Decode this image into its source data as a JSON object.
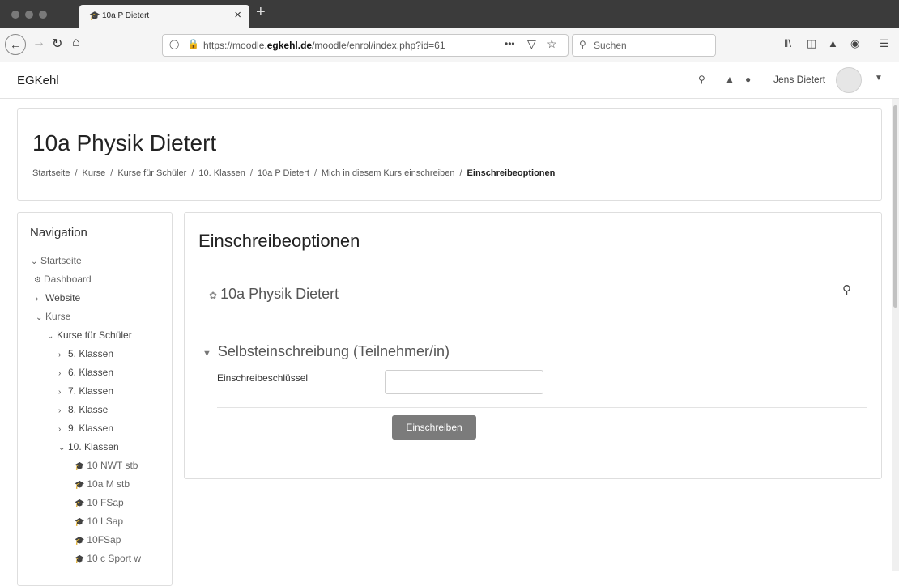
{
  "browser": {
    "tab_title": "10a P Dietert",
    "tab_favicon": "moodle-hat-icon",
    "url_prefix": "https://moodle.",
    "url_domain": "egkehl.de",
    "url_path": "/moodle/enrol/index.php?id=61",
    "search_placeholder": "Suchen",
    "more_label": "•••"
  },
  "site": {
    "brand": "EGKehl",
    "user_name": "Jens Dietert"
  },
  "header": {
    "title": "10a Physik Dietert",
    "breadcrumb": [
      "Startseite",
      "Kurse",
      "Kurse für Schüler",
      "10. Klassen",
      "10a P Dietert",
      "Mich in diesem Kurs einschreiben",
      "Einschreibeoptionen"
    ]
  },
  "navigation": {
    "title": "Navigation",
    "items": [
      {
        "label": "Startseite"
      },
      {
        "label": "Dashboard"
      },
      {
        "label": "Website"
      },
      {
        "label": "Kurse"
      },
      {
        "label": "Kurse für Schüler"
      },
      {
        "label": "5. Klassen"
      },
      {
        "label": "6. Klassen"
      },
      {
        "label": "7. Klassen"
      },
      {
        "label": "8. Klasse"
      },
      {
        "label": "9. Klassen"
      },
      {
        "label": "10. Klassen"
      },
      {
        "label": "10 NWT stb"
      },
      {
        "label": "10a M stb"
      },
      {
        "label": "10 FSap"
      },
      {
        "label": "10 LSap"
      },
      {
        "label": "10FSap"
      },
      {
        "label": "10 c Sport w"
      }
    ]
  },
  "main": {
    "title": "Einschreibeoptionen",
    "course_name": "10a Physik Dietert",
    "section_title": "Selbsteinschreibung (Teilnehmer/in)",
    "key_label": "Einschreibeschlüssel",
    "key_value": "",
    "submit_label": "Einschreiben"
  }
}
